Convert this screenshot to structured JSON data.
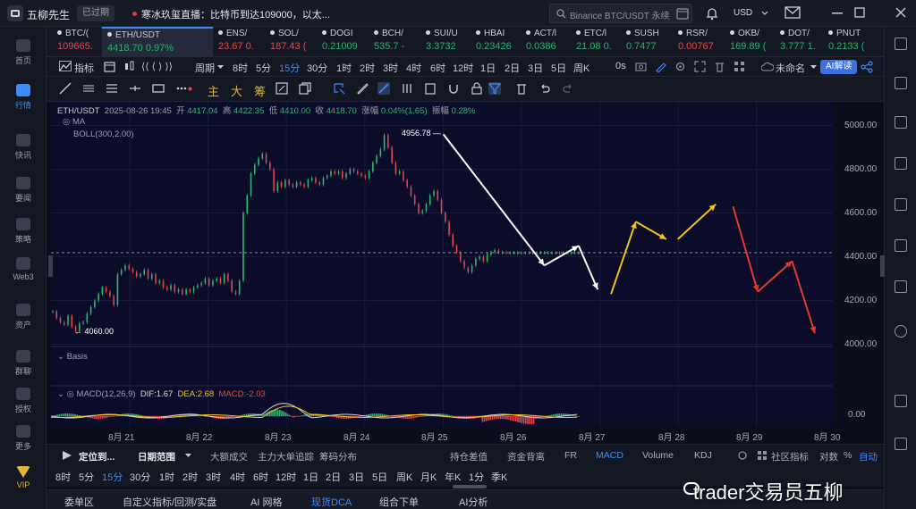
{
  "app": {
    "name": "五柳先生",
    "expired_badge": "已过期",
    "news_ticker": "寒冰玖玺直播：比特币到达109000，以太...",
    "search_placeholder": "Binance BTC/USDT 永续",
    "currency": "USD"
  },
  "left_nav": [
    {
      "label": "首页",
      "icon": "home-icon"
    },
    {
      "label": "行情",
      "icon": "chart-bars-icon",
      "active": true
    },
    {
      "label": "快讯",
      "icon": "news-icon"
    },
    {
      "label": "要闻",
      "icon": "document-icon"
    },
    {
      "label": "策略",
      "icon": "robot-icon"
    },
    {
      "label": "Web3",
      "icon": "web3-icon"
    },
    {
      "label": "资产",
      "icon": "wallet-icon"
    },
    {
      "label": "群聊",
      "icon": "chat-icon"
    },
    {
      "label": "授权",
      "icon": "key-icon"
    },
    {
      "label": "更多",
      "icon": "more-icon"
    },
    {
      "label": "VIP",
      "icon": "vip-icon"
    }
  ],
  "tabs": [
    {
      "name": "BTC/(",
      "price": "109665.",
      "dir": "dn"
    },
    {
      "name": "ETH/USDT",
      "price": "4418.70",
      "change": "0.97%",
      "dir": "up",
      "active": true
    },
    {
      "name": "ENS/",
      "price": "23.67",
      "extra": "0.",
      "dir": "dn"
    },
    {
      "name": "SOL/",
      "price": "187.43",
      "extra": "(",
      "dir": "dn"
    },
    {
      "name": "DOGI",
      "price": "0.21009",
      "dir": "up"
    },
    {
      "name": "BCH/",
      "price": "535.7",
      "extra": "-",
      "dir": "up"
    },
    {
      "name": "SUI/U",
      "price": "3.3732",
      "dir": "up"
    },
    {
      "name": "HBAI",
      "price": "0.23426",
      "dir": "up"
    },
    {
      "name": "ACT/l",
      "price": "0.0386",
      "dir": "up"
    },
    {
      "name": "ETC/l",
      "price": "21.08",
      "extra": "0.",
      "dir": "up"
    },
    {
      "name": "SUSH",
      "price": "0.7477",
      "dir": "up"
    },
    {
      "name": "RSR/",
      "price": "0.00767",
      "dir": "dn"
    },
    {
      "name": "OKB/",
      "price": "169.89",
      "extra": "(",
      "dir": "up"
    },
    {
      "name": "DOT/",
      "price": "3.777",
      "extra": "1.",
      "dir": "up"
    },
    {
      "name": "PNUT",
      "price": "0.2133",
      "extra": "(",
      "dir": "up"
    }
  ],
  "toolbar": {
    "indicators": "指标",
    "period": "周期",
    "timeframes": [
      "8时",
      "5分",
      "15分",
      "30分",
      "1时",
      "2时",
      "3时",
      "4时",
      "6时",
      "12时",
      "1日",
      "2日",
      "3日",
      "5日",
      "周K"
    ],
    "selected_timeframe": "15分",
    "zero_s": "0s",
    "unnamed": "未命名",
    "ai_label": "AI解读"
  },
  "draw_tools": {
    "main": "主",
    "big": "大",
    "chips": "筹"
  },
  "chart_header": {
    "symbol": "ETH/USDT",
    "datetime": "2025-08-26 19:45",
    "open_label": "开",
    "open": "4417.04",
    "high_label": "高",
    "high": "4422.35",
    "low_label": "低",
    "low": "4410.00",
    "close_label": "收",
    "close": "4418.70",
    "change_label": "涨幅",
    "change": "0.04%(1.65)",
    "amp_label": "振幅",
    "amp": "0.28%",
    "ma_label": "MA",
    "boll_label": "BOLL(300,2.00)",
    "basis_label": "Basis",
    "macd_label": "MACD(12,26,9)",
    "dif": "DIF:1.67",
    "dea": "DEA:2.68",
    "macd": "MACD:-2.03"
  },
  "chart_data": {
    "type": "line",
    "ylim": [
      3900,
      5100
    ],
    "yticks": [
      "5000.00",
      "4800.00",
      "4600.00",
      "4400.00",
      "4200.00",
      "4000.00"
    ],
    "macd_tick": "0.00",
    "xticks": [
      "8月 21",
      "8月 22",
      "8月 23",
      "8月 24",
      "8月 25",
      "8月 26",
      "8月 27",
      "8月 28",
      "8月 29",
      "8月 30"
    ],
    "annotations": {
      "high": "4956.78",
      "low": "4060.00"
    },
    "price_path": {
      "x": [
        0,
        2,
        4,
        6,
        8,
        10,
        12,
        14,
        16,
        18,
        20,
        22,
        24,
        26,
        28,
        30,
        32,
        34,
        36,
        38,
        40,
        42,
        44,
        46,
        48,
        50,
        52,
        54,
        56,
        58,
        60,
        62,
        64,
        66,
        68,
        70,
        72,
        74,
        76,
        78,
        80,
        82,
        84,
        86,
        88,
        90,
        92,
        94,
        96,
        98,
        100,
        102,
        104,
        106,
        108,
        110,
        112,
        114,
        116,
        118,
        120,
        122,
        124,
        126,
        128,
        130,
        132,
        134,
        136,
        138,
        140,
        142,
        144,
        146,
        148,
        150,
        152,
        154,
        156,
        158,
        160,
        162,
        164,
        166,
        168,
        170,
        172,
        174,
        176,
        178,
        180,
        182,
        184,
        186,
        188,
        190,
        192,
        194,
        196,
        198,
        200,
        202,
        204,
        206,
        208,
        210,
        212,
        214,
        216,
        218,
        220,
        222,
        224,
        226,
        228,
        230,
        232,
        234,
        236,
        238,
        240,
        242,
        244,
        246,
        248,
        250,
        252,
        254,
        256,
        258,
        260,
        262,
        264,
        266,
        268,
        270,
        272,
        274,
        276
      ],
      "y": [
        4150,
        4120,
        4100,
        4090,
        4130,
        4080,
        4060,
        4095,
        4100,
        4140,
        4170,
        4200,
        4230,
        4260,
        4240,
        4220,
        4180,
        4320,
        4340,
        4360,
        4345,
        4330,
        4310,
        4320,
        4340,
        4300,
        4320,
        4280,
        4290,
        4260,
        4250,
        4270,
        4240,
        4250,
        4230,
        4250,
        4240,
        4260,
        4270,
        4280,
        4300,
        4270,
        4290,
        4300,
        4280,
        4320,
        4290,
        4240,
        4230,
        4290,
        4600,
        4680,
        4780,
        4820,
        4850,
        4870,
        4830,
        4800,
        4700,
        4740,
        4720,
        4750,
        4730,
        4720,
        4740,
        4730,
        4720,
        4750,
        4760,
        4740,
        4730,
        4760,
        4770,
        4790,
        4780,
        4790,
        4760,
        4780,
        4800,
        4790,
        4780,
        4770,
        4760,
        4790,
        4830,
        4860,
        4890,
        4956,
        4900,
        4830,
        4780,
        4790,
        4750,
        4720,
        4680,
        4640,
        4600,
        4610,
        4640,
        4680,
        4700,
        4660,
        4600,
        4560,
        4500,
        4450,
        4420,
        4380,
        4350,
        4330,
        4360,
        4390,
        4400,
        4380,
        4410,
        4420,
        4430,
        4418,
        4420,
        4418,
        4418,
        4418,
        4418,
        4418,
        4418,
        4418,
        4418,
        4418,
        4418,
        4418,
        4418,
        4418,
        4418,
        4418,
        4418,
        4418,
        4418,
        4418,
        4418
      ]
    }
  },
  "indicator_row": {
    "locate": "定位到...",
    "date_range": "日期范围",
    "items": [
      "大额成交",
      "主力大单追踪",
      "筹码分布",
      "持仓差值",
      "资金背离",
      "FR",
      "MACD",
      "Volume",
      "KDJ"
    ],
    "selected": "MACD",
    "community": "社区指标",
    "log_scale": "对数",
    "percent": "%",
    "auto": "自动"
  },
  "tf2": [
    "8时",
    "5分",
    "15分",
    "30分",
    "1时",
    "2时",
    "3时",
    "4时",
    "6时",
    "12时",
    "1日",
    "2日",
    "3日",
    "5日",
    "周K",
    "月K",
    "年K",
    "1分",
    "季K"
  ],
  "tf2_selected": "15分",
  "bottom_tabs": [
    "委单区",
    "自定义指标/回测/实盘",
    "AI 网格",
    "现货DCA",
    "组合下单",
    "AI分析"
  ],
  "bottom_selected": "现货DCA",
  "watermark": "trader交易员五柳",
  "colors": {
    "accent": "#3d8bfd",
    "up": "#27b36a",
    "down": "#e24a4a",
    "candle_up": "#2eb872",
    "candle_down": "#e0464e",
    "forecast_white": "#ffffff",
    "forecast_yellow": "#f2c218",
    "forecast_red": "#e33b2a"
  }
}
